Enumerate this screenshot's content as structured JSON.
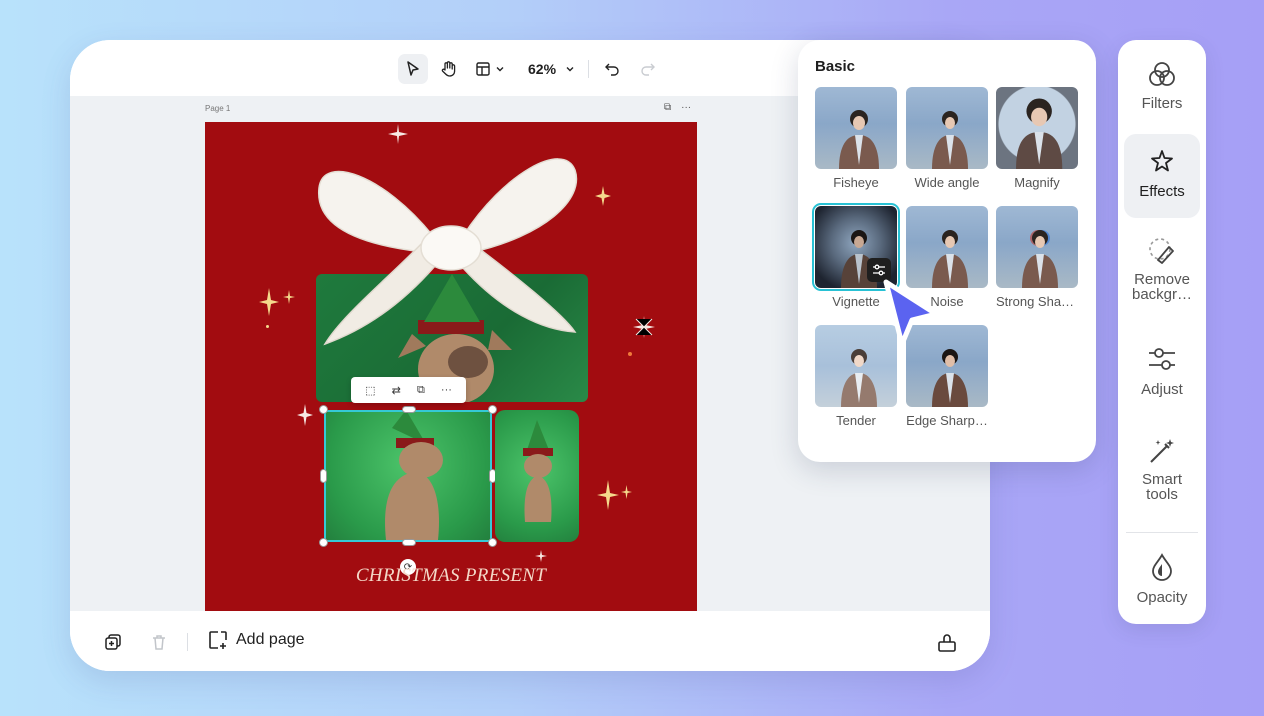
{
  "toolbar": {
    "zoom": "62%"
  },
  "canvas": {
    "page_label": "Page 1",
    "poster_title": "CHRISTMAS PRESENT"
  },
  "bottombar": {
    "add_page_label": "Add page"
  },
  "effects_panel": {
    "section_title": "Basic",
    "effects": [
      {
        "label": "Fisheye",
        "selected": false
      },
      {
        "label": "Wide angle",
        "selected": false
      },
      {
        "label": "Magnify",
        "selected": false
      },
      {
        "label": "Vignette",
        "selected": true
      },
      {
        "label": "Noise",
        "selected": false
      },
      {
        "label": "Strong Shar…",
        "selected": false
      },
      {
        "label": "Tender",
        "selected": false
      },
      {
        "label": "Edge Sharp…",
        "selected": false
      }
    ]
  },
  "sidebar": {
    "items": [
      {
        "label": "Filters",
        "icon": "filters-icon",
        "active": false
      },
      {
        "label": "Effects",
        "icon": "effects-icon",
        "active": true
      },
      {
        "label": "Remove backgr…",
        "icon": "remove-background-icon",
        "active": false
      },
      {
        "label": "Adjust",
        "icon": "adjust-icon",
        "active": false
      },
      {
        "label": "Smart tools",
        "icon": "smart-tools-icon",
        "active": false
      },
      {
        "label": "Opacity",
        "icon": "opacity-icon",
        "active": false
      }
    ]
  },
  "colors": {
    "accent": "#5b63f0",
    "selection": "#35c9d6",
    "poster_red": "#a20c10"
  }
}
